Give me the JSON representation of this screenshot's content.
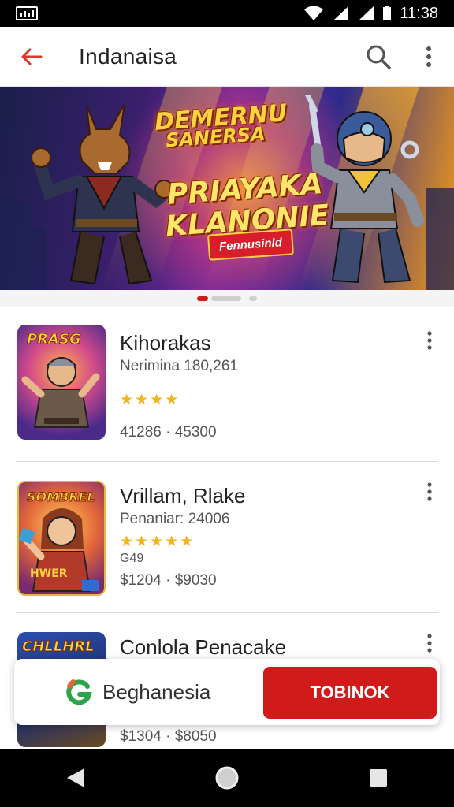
{
  "status_bar": {
    "time": "11:38"
  },
  "app_bar": {
    "title": "Indanaisa"
  },
  "banner": {
    "line1": "DEMERNU",
    "line2": "SANERSA",
    "line3": "PRIAYAKA",
    "line4": "KLANONIE",
    "cta": "Fennusinld"
  },
  "list": [
    {
      "title": "Kihorakas",
      "subtitle": "Nerimina 180,261",
      "rating": "★★★★",
      "meta": "41286 · 45300"
    },
    {
      "title": "Vrillam, Rlake",
      "subtitle": "Penaniar: 24006",
      "rating": "★★★★★",
      "extra": "G49",
      "meta": "$1204 · $9030"
    },
    {
      "title": "Conlola Penacake",
      "meta": "$1304 · $8050"
    }
  ],
  "overlay": {
    "name": "Beghanesia",
    "button_label": "TOBINOK"
  },
  "colors": {
    "accent": "#d11a1a",
    "star": "#f3b41a"
  }
}
